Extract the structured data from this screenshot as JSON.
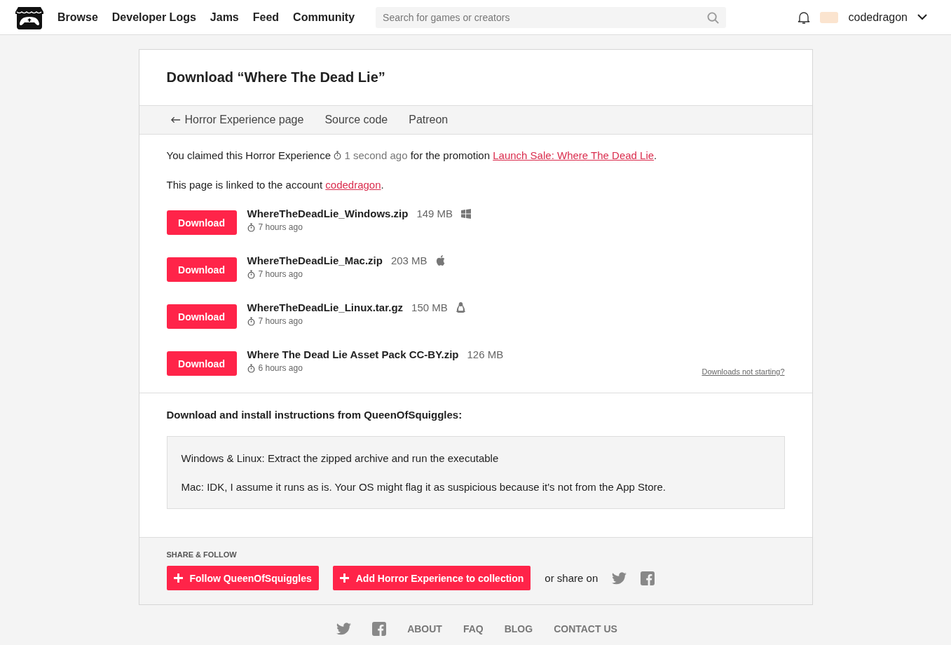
{
  "nav": {
    "items": [
      "Browse",
      "Developer Logs",
      "Jams",
      "Feed",
      "Community"
    ],
    "search": {
      "placeholder": "Search for games or creators"
    },
    "user": "codedragon"
  },
  "title": "Download “Where The Dead Lie”",
  "tabs": [
    {
      "label": "Horror Experience page",
      "kind": "back"
    },
    {
      "label": "Source code",
      "kind": "plain"
    },
    {
      "label": "Patreon",
      "kind": "plain"
    }
  ],
  "claim": {
    "before": "You claimed this Horror Experience",
    "time": "1 second ago",
    "middle": "for the promotion",
    "link": "Launch Sale: Where The Dead Lie",
    "after": "."
  },
  "linked": {
    "before": "This page is linked to the account",
    "link": "codedragon",
    "after": "."
  },
  "files": [
    {
      "button": "Download",
      "name": "WhereTheDeadLie_Windows.zip",
      "size": "149 MB",
      "kind": "windows",
      "time": "7 hours ago"
    },
    {
      "button": "Download",
      "name": "WhereTheDeadLie_Mac.zip",
      "size": "203 MB",
      "kind": "mac",
      "time": "7 hours ago"
    },
    {
      "button": "Download",
      "name": "WhereTheDeadLie_Linux.tar.gz",
      "size": "150 MB",
      "kind": "linux",
      "time": "7 hours ago"
    },
    {
      "button": "Download",
      "name": "Where The Dead Lie Asset Pack CC-BY.zip",
      "size": "126 MB",
      "kind": "plain",
      "time": "6 hours ago"
    }
  ],
  "help_link": "Downloads not starting?",
  "instructions": {
    "heading": "Download and install instructions from QueenOfSquiggles:",
    "paragraphs": [
      "Windows & Linux: Extract the zipped archive and run the executable",
      "Mac: IDK, I assume it runs as is. Your OS might flag it as suspicious because it's not from the App Store."
    ]
  },
  "share": {
    "heading": "SHARE & FOLLOW",
    "buttons": [
      "Follow QueenOfSquiggles",
      "Add Horror Experience to collection"
    ],
    "share_text": "or share on"
  },
  "footer": [
    "ABOUT",
    "FAQ",
    "BLOG",
    "CONTACT US"
  ]
}
